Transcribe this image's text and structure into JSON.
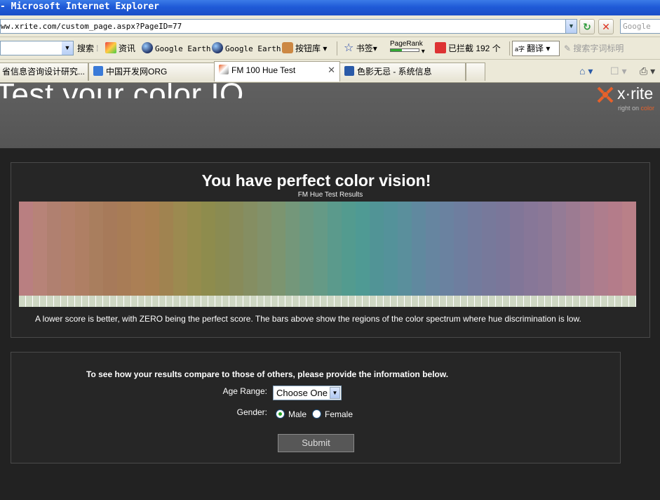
{
  "window": {
    "title": "- Microsoft Internet Explorer"
  },
  "address": {
    "url": "ww.xrite.com/custom_page.aspx?PageID=77",
    "search_placeholder": "Google"
  },
  "toolbar": {
    "search_label": "搜索",
    "news_label": "资讯",
    "google_earth_1": "Google Earth",
    "google_earth_2": "Google Earth",
    "button_library": "按钮库",
    "bookmarks": "书签",
    "pagerank": "PageRank",
    "blocked_label": "已拦截 192 个",
    "translate": "翻译",
    "search_highlight": "搜索字词标明"
  },
  "tabs": [
    {
      "label": "省信息咨询设计研究...",
      "active": false
    },
    {
      "label": "中国开发网ORG",
      "active": false
    },
    {
      "label": "FM 100 Hue Test",
      "active": true
    },
    {
      "label": "色影无忌 - 系统信息",
      "active": false
    }
  ],
  "header": {
    "title": "Test your color IQ",
    "logo": "x·rite",
    "logo_tag_1": "right on ",
    "logo_tag_2": "color"
  },
  "results": {
    "headline": "You have perfect color vision!",
    "subhead": "FM Hue Test Results",
    "caption": "A lower score is better, with ZERO being the perfect score. The bars above show the regions of the color spectrum where hue discrimination is low.",
    "spectrum_colors": [
      "#b97f81",
      "#b78378",
      "#b08070",
      "#b2806a",
      "#af7f64",
      "#a97e5e",
      "#a77a5a",
      "#a87c56",
      "#ab7f55",
      "#a98051",
      "#a08350",
      "#9c8a50",
      "#958c4d",
      "#8e8c4d",
      "#8a8b52",
      "#888b5a",
      "#858e62",
      "#82916a",
      "#7c9570",
      "#74977a",
      "#6b9880",
      "#659a86",
      "#5b9a8c",
      "#539b8f",
      "#4f9a94",
      "#519496",
      "#54929a",
      "#5a8f9c",
      "#60899f",
      "#6685a0",
      "#6a82a0",
      "#6e7e9f",
      "#737b9d",
      "#77799b",
      "#7a779a",
      "#817698",
      "#877798",
      "#8b7897",
      "#947b96",
      "#9c7b92",
      "#a57c91",
      "#ae7d8d",
      "#b47c8a",
      "#b98088"
    ],
    "tick_count": 88
  },
  "form": {
    "intro": "To see how your results compare to those of others, please provide the information below.",
    "age_label": "Age Range:",
    "age_value": "Choose One",
    "gender_label": "Gender:",
    "male": "Male",
    "female": "Female",
    "gender_selected": "male",
    "submit": "Submit"
  },
  "colors": {
    "page_bg": "#222222",
    "header_bg": "#5a5a5a",
    "brand_orange": "#e7612a"
  }
}
